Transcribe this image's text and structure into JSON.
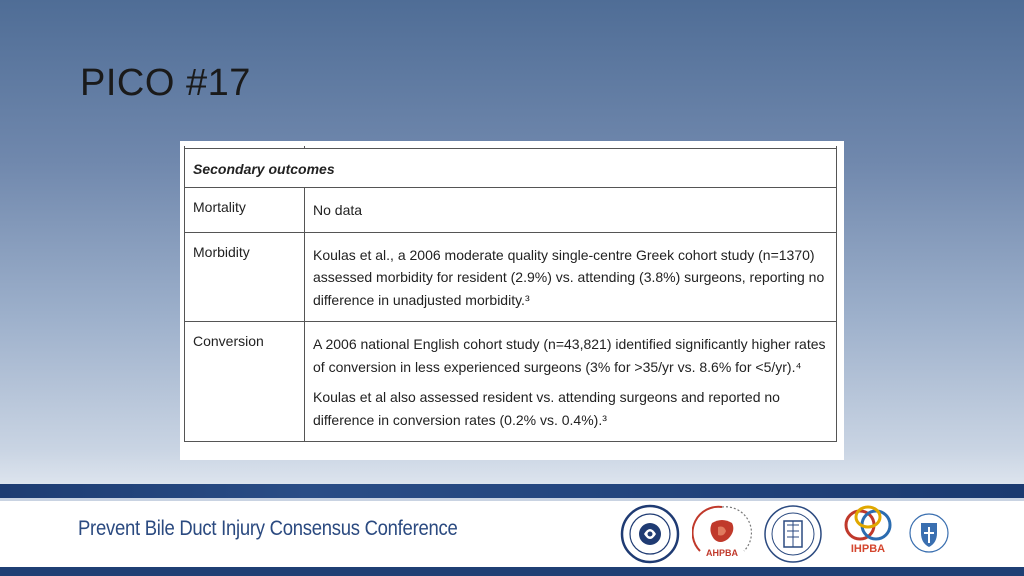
{
  "slide": {
    "title": "PICO #17"
  },
  "table": {
    "section_header": "Secondary outcomes",
    "rows": [
      {
        "label": "Mortality",
        "paragraphs": [
          "No data"
        ]
      },
      {
        "label": "Morbidity",
        "paragraphs": [
          "Koulas et al., a 2006 moderate quality single-centre Greek cohort study (n=1370) assessed morbidity for resident (2.9%) vs. attending (3.8%) surgeons, reporting no difference in unadjusted morbidity.³"
        ]
      },
      {
        "label": "Conversion",
        "paragraphs": [
          "A 2006 national English cohort study (n=43,821) identified significantly higher rates of conversion in less experienced surgeons (3% for >35/yr vs. 8.6% for <5/yr).⁴",
          "Koulas et al also assessed resident vs. attending surgeons and reported no difference in conversion rates (0.2% vs. 0.4%).³"
        ]
      }
    ]
  },
  "footer": {
    "conference_title": "Prevent Bile Duct Injury Consensus Conference",
    "logos": [
      {
        "icon": "society-seal-logo-icon"
      },
      {
        "icon": "ahpba-logo-icon",
        "caption": "AHPBA",
        "caption_color": "#c0392b"
      },
      {
        "icon": "eaes-logo-icon"
      },
      {
        "icon": "ihpba-logo-icon",
        "caption": "IHPBA",
        "caption_color": "#d4462e"
      },
      {
        "icon": "ssat-logo-icon"
      }
    ]
  }
}
